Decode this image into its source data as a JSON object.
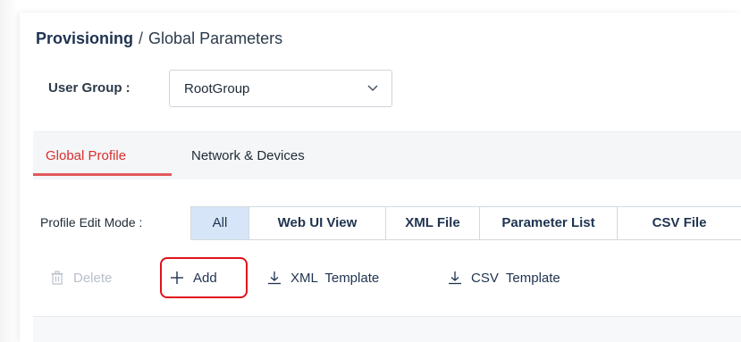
{
  "breadcrumb": {
    "root": "Provisioning",
    "separator": "/",
    "current": "Global Parameters"
  },
  "user_group": {
    "label": "User Group :",
    "value": "RootGroup"
  },
  "tabs": [
    {
      "label": "Global Profile",
      "active": true
    },
    {
      "label": "Network & Devices",
      "active": false
    }
  ],
  "profile_edit_mode": {
    "label": "Profile Edit Mode :",
    "options": [
      {
        "label": "All",
        "active": true
      },
      {
        "label": "Web UI View",
        "active": false
      },
      {
        "label": "XML File",
        "active": false
      },
      {
        "label": "Parameter List",
        "active": false
      },
      {
        "label": "CSV File",
        "active": false
      }
    ]
  },
  "toolbar": {
    "delete_label": "Delete",
    "add_label": "Add",
    "xml_template_label": "XML  Template",
    "csv_template_label": "CSV  Template"
  },
  "icons": {
    "delete": "trash-icon",
    "add": "plus-icon",
    "xml_template": "download-icon",
    "csv_template": "download-icon",
    "select": "chevron-down-icon"
  },
  "colors": {
    "active_tab": "#d9302e",
    "active_segment_bg": "#d6e6f8",
    "highlight": "#e0121b"
  }
}
